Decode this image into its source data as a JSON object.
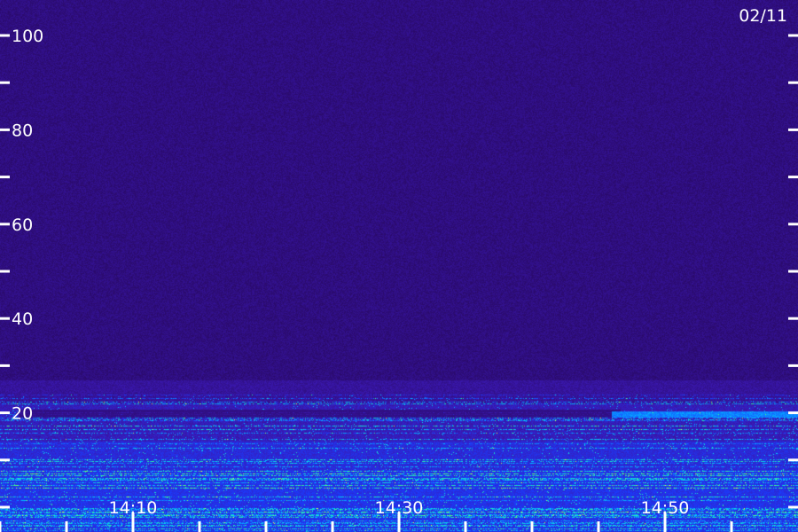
{
  "chart_data": {
    "type": "heatmap",
    "title": "",
    "date_label": "02/11",
    "xlabel": "",
    "ylabel": "",
    "ylim": [
      0,
      102
    ],
    "y_ticks_labeled": [
      {
        "value": 20,
        "label": "20"
      },
      {
        "value": 40,
        "label": "40"
      },
      {
        "value": 60,
        "label": "60"
      },
      {
        "value": 80,
        "label": "80"
      },
      {
        "value": 100,
        "label": "100"
      }
    ],
    "y_ticks_minor": [
      0,
      10,
      30,
      50,
      70,
      90
    ],
    "x_ticks_labeled": [
      {
        "value": "14:10",
        "label": "14:10"
      },
      {
        "value": "14:30",
        "label": "14:30"
      },
      {
        "value": "14:50",
        "label": "14:50"
      }
    ],
    "x_ticks_minor": [
      "14:00",
      "14:05",
      "14:15",
      "14:20",
      "14:25",
      "14:35",
      "14:40",
      "14:45",
      "14:55"
    ],
    "colormap": [
      "#2a0a6a",
      "#3a18b0",
      "#1a3cff",
      "#00c8ff",
      "#40ff80",
      "#ffff40"
    ],
    "description_bands": [
      {
        "y_from": 0,
        "y_to": 12,
        "intensity": "high"
      },
      {
        "y_from": 12,
        "y_to": 22,
        "intensity": "medium"
      },
      {
        "y_from": 22,
        "y_to": 27,
        "intensity": "low"
      }
    ]
  }
}
